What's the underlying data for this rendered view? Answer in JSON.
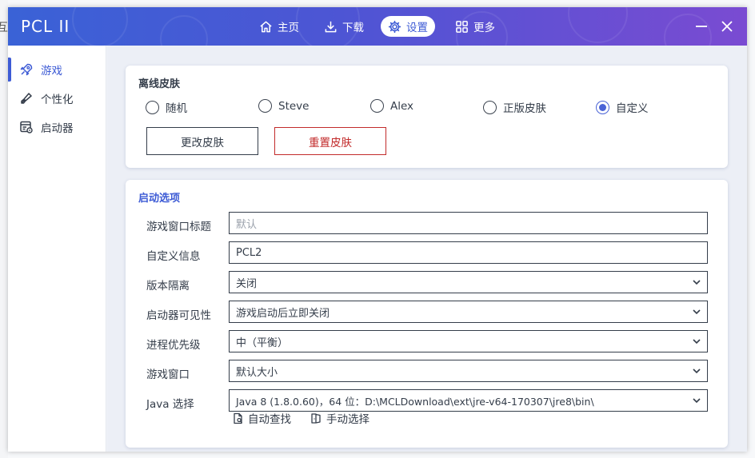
{
  "bleed": {
    "text": "互"
  },
  "app": {
    "title": "PCL II"
  },
  "nav": [
    {
      "label": "主页",
      "icon": "home-icon"
    },
    {
      "label": "下载",
      "icon": "download-icon"
    },
    {
      "label": "设置",
      "icon": "gear-icon",
      "active": true
    },
    {
      "label": "更多",
      "icon": "grid-icon"
    }
  ],
  "sidebar": {
    "items": [
      {
        "label": "游戏",
        "icon": "rocket-icon",
        "active": true
      },
      {
        "label": "个性化",
        "icon": "brush-icon"
      },
      {
        "label": "启动器",
        "icon": "launcher-icon"
      }
    ]
  },
  "skin": {
    "title": "离线皮肤",
    "options": [
      {
        "label": "随机",
        "checked": false
      },
      {
        "label": "Steve",
        "checked": false
      },
      {
        "label": "Alex",
        "checked": false
      },
      {
        "label": "正版皮肤",
        "checked": false
      },
      {
        "label": "自定义",
        "checked": true
      }
    ],
    "change_button": "更改皮肤",
    "reset_button": "重置皮肤"
  },
  "launch": {
    "title": "启动选项",
    "rows": [
      {
        "label": "游戏窗口标题",
        "value": "",
        "placeholder": "默认",
        "type": "text"
      },
      {
        "label": "自定义信息",
        "value": "PCL2",
        "type": "text"
      },
      {
        "label": "版本隔离",
        "value": "关闭",
        "type": "select"
      },
      {
        "label": "启动器可见性",
        "value": "游戏启动后立即关闭",
        "type": "select"
      },
      {
        "label": "进程优先级",
        "value": "中（平衡）",
        "type": "select"
      },
      {
        "label": "游戏窗口",
        "value": "默认大小",
        "type": "select"
      },
      {
        "label": "Java 选择",
        "value": "Java 8 (1.8.0.60)，64 位：D:\\MCLDownload\\ext\\jre-v64-170307\\jre8\\bin\\",
        "type": "select"
      }
    ],
    "auto_find": "自动查找",
    "manual_select": "手动选择"
  },
  "colors": {
    "accent": "#3d5bd5",
    "danger": "#c22b2b",
    "titlebar_start": "#3a62d6",
    "titlebar_end": "#7a4bd2"
  }
}
